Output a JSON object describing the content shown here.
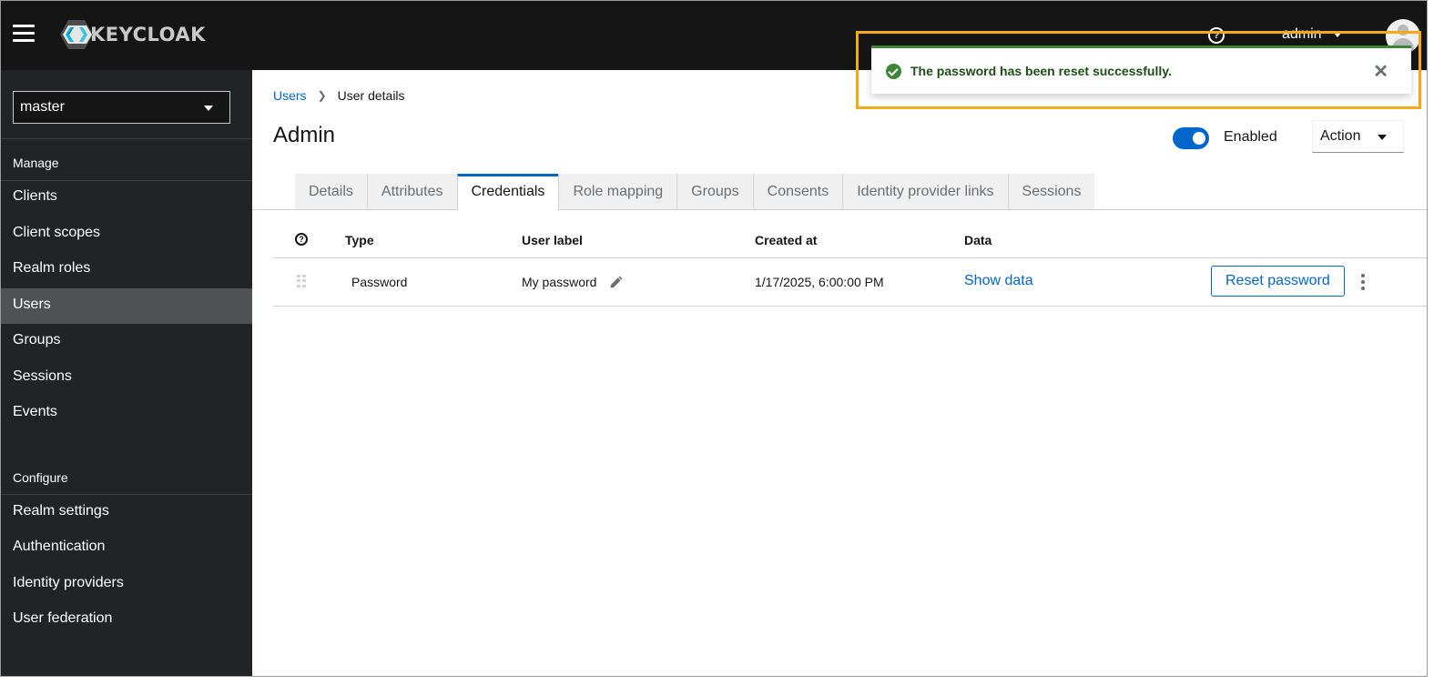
{
  "masthead": {
    "brand": "KEYCLOAK",
    "help_icon": "help-circle-icon",
    "user_name": "admin"
  },
  "sidebar": {
    "realm": "master",
    "sections": [
      {
        "title": "Manage",
        "items": [
          {
            "label": "Clients",
            "active": false
          },
          {
            "label": "Client scopes",
            "active": false
          },
          {
            "label": "Realm roles",
            "active": false
          },
          {
            "label": "Users",
            "active": true
          },
          {
            "label": "Groups",
            "active": false
          },
          {
            "label": "Sessions",
            "active": false
          },
          {
            "label": "Events",
            "active": false
          }
        ]
      },
      {
        "title": "Configure",
        "items": [
          {
            "label": "Realm settings",
            "active": false
          },
          {
            "label": "Authentication",
            "active": false
          },
          {
            "label": "Identity providers",
            "active": false
          },
          {
            "label": "User federation",
            "active": false
          }
        ]
      }
    ]
  },
  "breadcrumb": [
    {
      "label": "Users",
      "link": true
    },
    {
      "label": "User details",
      "link": false
    }
  ],
  "page": {
    "title": "Admin",
    "enabled_label": "Enabled",
    "enabled": true,
    "action_label": "Action"
  },
  "tabs": [
    {
      "label": "Details",
      "active": false
    },
    {
      "label": "Attributes",
      "active": false
    },
    {
      "label": "Credentials",
      "active": true
    },
    {
      "label": "Role mapping",
      "active": false
    },
    {
      "label": "Groups",
      "active": false
    },
    {
      "label": "Consents",
      "active": false
    },
    {
      "label": "Identity provider links",
      "active": false
    },
    {
      "label": "Sessions",
      "active": false
    }
  ],
  "credentials": {
    "columns": [
      "Type",
      "User label",
      "Created at",
      "Data"
    ],
    "rows": [
      {
        "type": "Password",
        "user_label": "My password",
        "created_at": "1/17/2025, 6:00:00 PM",
        "data_link": "Show data",
        "action_label": "Reset password"
      }
    ]
  },
  "toast": {
    "status": "success",
    "message": "The password has been reset successfully.",
    "color": "#3e8635"
  },
  "colors": {
    "accent": "#0066cc",
    "highlight": "#f4a917",
    "masthead": "#151515",
    "sidebar": "#212427"
  }
}
